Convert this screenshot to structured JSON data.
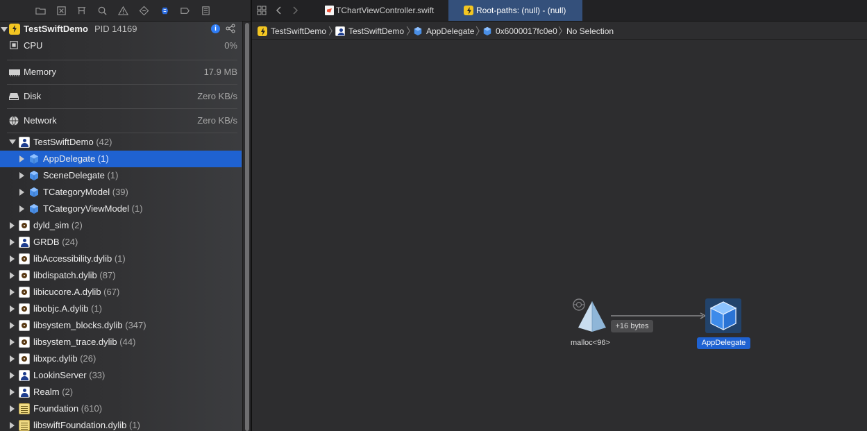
{
  "nav": {
    "process": {
      "name": "TestSwiftDemo",
      "pid": "PID 14169"
    },
    "gauges": [
      {
        "label": "CPU",
        "value": "0%"
      },
      {
        "label": "Memory",
        "value": "17.9 MB"
      },
      {
        "label": "Disk",
        "value": "Zero KB/s"
      },
      {
        "label": "Network",
        "value": "Zero KB/s"
      }
    ],
    "tree": [
      {
        "label": "TestSwiftDemo",
        "count": "(42)"
      },
      {
        "label": "AppDelegate",
        "count": "(1)"
      },
      {
        "label": "SceneDelegate",
        "count": "(1)"
      },
      {
        "label": "TCategoryModel",
        "count": "(39)"
      },
      {
        "label": "TCategoryViewModel",
        "count": "(1)"
      },
      {
        "label": "dyld_sim",
        "count": "(2)"
      },
      {
        "label": "GRDB",
        "count": "(24)"
      },
      {
        "label": "libAccessibility.dylib",
        "count": "(1)"
      },
      {
        "label": "libdispatch.dylib",
        "count": "(87)"
      },
      {
        "label": "libicucore.A.dylib",
        "count": "(67)"
      },
      {
        "label": "libobjc.A.dylib",
        "count": "(1)"
      },
      {
        "label": "libsystem_blocks.dylib",
        "count": "(347)"
      },
      {
        "label": "libsystem_trace.dylib",
        "count": "(44)"
      },
      {
        "label": "libxpc.dylib",
        "count": "(26)"
      },
      {
        "label": "LookinServer",
        "count": "(33)"
      },
      {
        "label": "Realm",
        "count": "(2)"
      },
      {
        "label": "Foundation",
        "count": "(610)"
      },
      {
        "label": "libswiftFoundation.dylib",
        "count": "(1)"
      }
    ]
  },
  "tabs": [
    {
      "label": "TChartViewController.swift"
    },
    {
      "label": "Root-paths: (null) - (null)"
    }
  ],
  "jumpbar": [
    {
      "label": "TestSwiftDemo"
    },
    {
      "label": "TestSwiftDemo"
    },
    {
      "label": "AppDelegate"
    },
    {
      "label": "0x6000017fc0e0"
    },
    {
      "label": "No Selection"
    }
  ],
  "graph": {
    "source_node": "malloc<96>",
    "edge_label": "+16 bytes",
    "target_node": "AppDelegate"
  },
  "colors": {
    "selection": "#1f62d1",
    "active_tab": "#34507b",
    "cube": "#4a90e2"
  }
}
